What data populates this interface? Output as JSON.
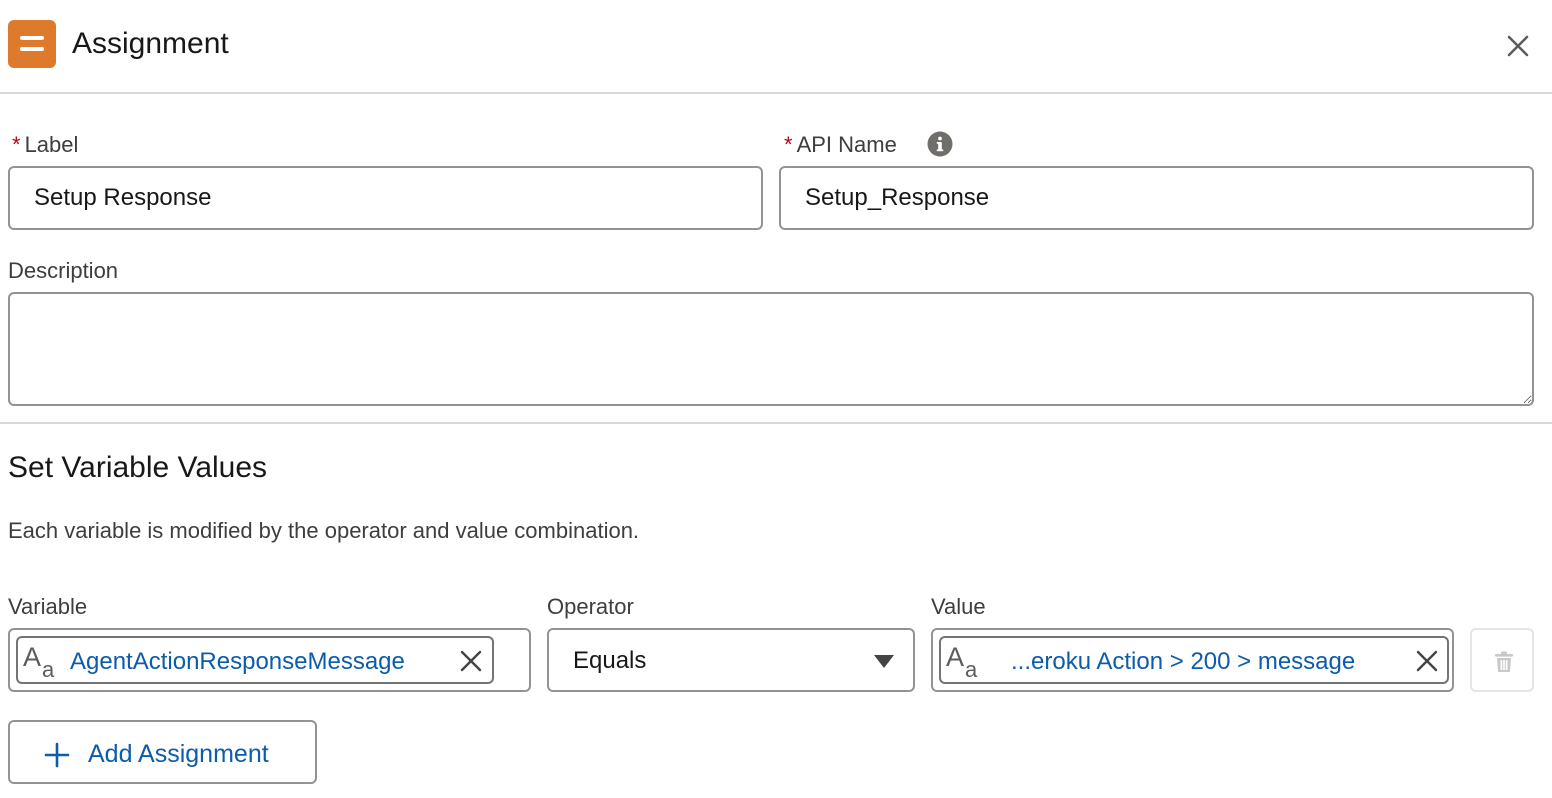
{
  "header": {
    "title": "Assignment",
    "icon": "assignment-icon",
    "icon_color": "#dd7a2b"
  },
  "form": {
    "label_field": {
      "label": "Label",
      "required_marker": "*",
      "value": "Setup Response"
    },
    "api_name_field": {
      "label": "API Name",
      "required_marker": "*",
      "value": "Setup_Response",
      "info_icon": "info-icon"
    },
    "description_field": {
      "label": "Description",
      "value": ""
    }
  },
  "variables_section": {
    "title": "Set Variable Values",
    "description": "Each variable is modified by the operator and value combination.",
    "columns": {
      "variable": "Variable",
      "operator": "Operator",
      "value": "Value"
    },
    "rows": [
      {
        "variable": "AgentActionResponseMessage",
        "variable_icon": "text-type-icon",
        "operator": "Equals",
        "value": "...eroku Action > 200 > message",
        "value_icon": "text-type-icon",
        "delete_enabled": false
      }
    ],
    "add_button_label": "Add Assignment"
  },
  "colors": {
    "accent_link": "#0b5cab",
    "required": "#ba0517",
    "border": "#939393"
  }
}
